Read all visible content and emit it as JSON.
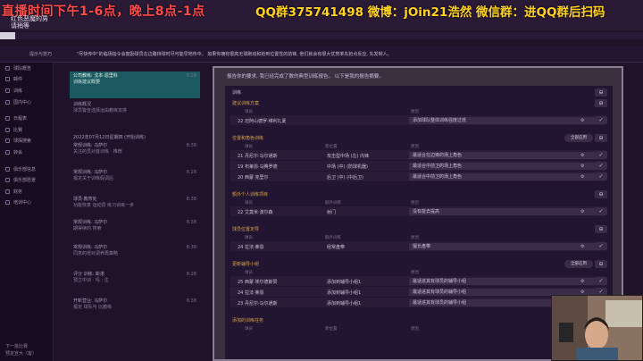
{
  "overlay": {
    "left_text": "直播时间下午1-6点，晚上8点-1点",
    "right_text": "QQ群375741498 微博：jOin21浩然 微信群：进QQ群后扫码",
    "sub_line1": "红色恶魔的男",
    "sub_line2": "请稍等"
  },
  "progress": {
    "fraction": 0.024
  },
  "notice": {
    "label": "提示与技巧",
    "message": "\"尽快传中\"的临场指令会鼓励球员在边路持球时尽可能早地传中。 如果你拥有很高无球跑动和抢到位置性的前锋, 他们就会有很大优势率先抢点反应, 先发制人。"
  },
  "sidebar": {
    "items": [
      {
        "name": "sidebar-item-club-report",
        "label": "球队概告"
      },
      {
        "name": "sidebar-item-inbox",
        "label": "邮件"
      },
      {
        "name": "sidebar-item-squad",
        "label": "训练"
      },
      {
        "name": "sidebar-item-coaching",
        "label": "国内中心"
      },
      {
        "name": "sidebar-item-schedule",
        "label": "日程表"
      },
      {
        "name": "sidebar-item-competition",
        "label": "比赛"
      },
      {
        "name": "sidebar-item-scouting",
        "label": "球探搜索"
      },
      {
        "name": "sidebar-item-transfers",
        "label": "转会"
      },
      {
        "name": "sidebar-item-club-info",
        "label": "俱乐部信息"
      },
      {
        "name": "sidebar-item-club-vision",
        "label": "俱乐部愿景"
      },
      {
        "name": "sidebar-item-finances",
        "label": "财务"
      },
      {
        "name": "sidebar-item-dev-centre",
        "label": "培训中心"
      }
    ],
    "bottom_line1": "下一批比赛",
    "bottom_line2": "预定宣大（客）"
  },
  "inbox": {
    "items": [
      {
        "title": "公司教练: 戈本·恩里科",
        "sub": "训练建议概要",
        "time": "8:28"
      },
      {
        "title": "训练概况",
        "sub": "球员警告选择运由教练安排",
        "time": ""
      },
      {
        "date": "2022年07月12日星期四 (开始训练)"
      },
      {
        "title": "常规训练: 马萨尔",
        "sub": "关注的员对首训练 · 推荐",
        "time": "8:38"
      },
      {
        "title": "常规训练: 马萨尔",
        "sub": "报定关于训练假调后",
        "time": "8:28"
      },
      {
        "title": "球员·教育处",
        "sub": "功能恢复 运动员 练习训练一步",
        "time": "8:38"
      },
      {
        "title": "常规训练: 马萨尔",
        "sub": "期得续的 搜索",
        "time": "8:38"
      },
      {
        "title": "常规训练: 马萨尔",
        "sub": "同意的增对调养再策略",
        "time": "8:38"
      },
      {
        "title": "评分 训练: 斯诺",
        "sub": "预立中训 · 吗 : 注",
        "time": "8:28"
      },
      {
        "title": "开新营业: 马萨尔",
        "sub": "报定 球队与 比教练",
        "time": "8:38"
      }
    ]
  },
  "panel": {
    "top_text": "报告你的要求, 我已经完成了数的典型训练报告。 以下是我的报告摘要。",
    "section_main": "训练",
    "sections": [
      {
        "title": "建议训练方案",
        "col1": "球员",
        "col2": "",
        "col3": "原因",
        "rows": [
          {
            "c1": "22 迈阿山德罗·维利扎夏",
            "c2": "",
            "c3": "添加球队整体训练强度过低"
          }
        ]
      },
      {
        "title": "位置和角色训练",
        "button": "全部应用",
        "col1": "球员",
        "col2": "新位置",
        "col3": "原因",
        "rows": [
          {
            "c1": "21 丹尼尔·马尔通斯",
            "c2": "攻击型中场 (左) 内锋",
            "c3": "最适合在边锋的场上角色"
          },
          {
            "c1": "19 布莱恩·马腾罗德",
            "c2": "中场 (中) (防球机器)",
            "c3": "最适合中前卫的场上角色"
          },
          {
            "c1": "20 西蒙·克里尔",
            "c2": "后卫 (中) (中后卫)",
            "c3": "最适合中前卫的场上角色"
          }
        ]
      },
      {
        "title": "额外个人训练项目",
        "col1": "球员",
        "col2": "额外训练",
        "col3": "原因",
        "rows": [
          {
            "c1": "22 艾莫米·波尔森",
            "c2": "射门",
            "c3": "没有能去提高"
          }
        ]
      },
      {
        "title": "球员位置定导",
        "col1": "球员",
        "col2": "额外训练",
        "col3": "原因",
        "rows": [
          {
            "c1": "24 拉法·莱恩",
            "c2": "经常盘带",
            "c3": "擅长盘带"
          }
        ]
      },
      {
        "title": "更新辅导小组",
        "button": "全部应用",
        "col1": "球员",
        "col2": "",
        "col3": "原因",
        "rows": [
          {
            "c1": "25 西蒙·埃尔德斯赞",
            "c2": "添加到辅导小组1",
            "c3": "最适进其有球员的辅导小组"
          },
          {
            "c1": "24 拉法·莱恩",
            "c2": "添加到辅导小组1",
            "c3": "最适进其有球员的辅导小组"
          },
          {
            "c1": "23 丹尼尔·马尔通斯",
            "c2": "添加到辅导小组1",
            "c3": "最适进其有球员的辅导小组"
          }
        ]
      },
      {
        "title": "添加的训练任务",
        "col1": "球员",
        "col2": "新位置",
        "col3": "原因",
        "rows": []
      }
    ]
  }
}
